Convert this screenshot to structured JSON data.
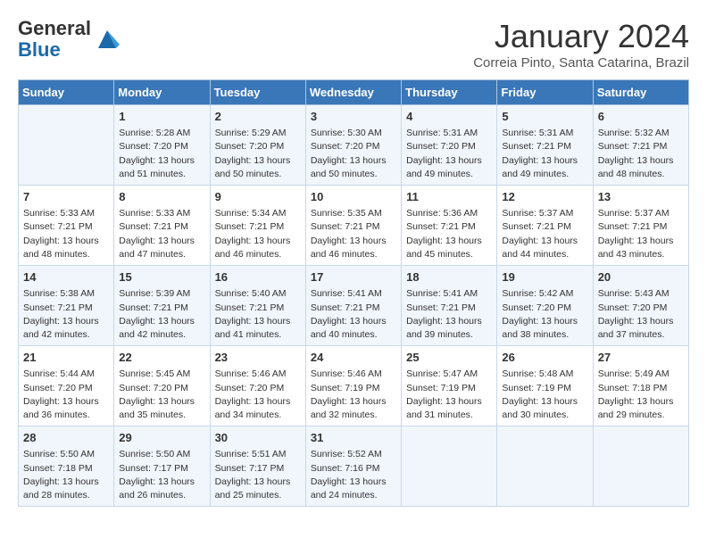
{
  "header": {
    "logo_line1": "General",
    "logo_line2": "Blue",
    "month_title": "January 2024",
    "location": "Correia Pinto, Santa Catarina, Brazil"
  },
  "calendar": {
    "days_of_week": [
      "Sunday",
      "Monday",
      "Tuesday",
      "Wednesday",
      "Thursday",
      "Friday",
      "Saturday"
    ],
    "weeks": [
      [
        {
          "day": "",
          "info": ""
        },
        {
          "day": "1",
          "info": "Sunrise: 5:28 AM\nSunset: 7:20 PM\nDaylight: 13 hours\nand 51 minutes."
        },
        {
          "day": "2",
          "info": "Sunrise: 5:29 AM\nSunset: 7:20 PM\nDaylight: 13 hours\nand 50 minutes."
        },
        {
          "day": "3",
          "info": "Sunrise: 5:30 AM\nSunset: 7:20 PM\nDaylight: 13 hours\nand 50 minutes."
        },
        {
          "day": "4",
          "info": "Sunrise: 5:31 AM\nSunset: 7:20 PM\nDaylight: 13 hours\nand 49 minutes."
        },
        {
          "day": "5",
          "info": "Sunrise: 5:31 AM\nSunset: 7:21 PM\nDaylight: 13 hours\nand 49 minutes."
        },
        {
          "day": "6",
          "info": "Sunrise: 5:32 AM\nSunset: 7:21 PM\nDaylight: 13 hours\nand 48 minutes."
        }
      ],
      [
        {
          "day": "7",
          "info": "Sunrise: 5:33 AM\nSunset: 7:21 PM\nDaylight: 13 hours\nand 48 minutes."
        },
        {
          "day": "8",
          "info": "Sunrise: 5:33 AM\nSunset: 7:21 PM\nDaylight: 13 hours\nand 47 minutes."
        },
        {
          "day": "9",
          "info": "Sunrise: 5:34 AM\nSunset: 7:21 PM\nDaylight: 13 hours\nand 46 minutes."
        },
        {
          "day": "10",
          "info": "Sunrise: 5:35 AM\nSunset: 7:21 PM\nDaylight: 13 hours\nand 46 minutes."
        },
        {
          "day": "11",
          "info": "Sunrise: 5:36 AM\nSunset: 7:21 PM\nDaylight: 13 hours\nand 45 minutes."
        },
        {
          "day": "12",
          "info": "Sunrise: 5:37 AM\nSunset: 7:21 PM\nDaylight: 13 hours\nand 44 minutes."
        },
        {
          "day": "13",
          "info": "Sunrise: 5:37 AM\nSunset: 7:21 PM\nDaylight: 13 hours\nand 43 minutes."
        }
      ],
      [
        {
          "day": "14",
          "info": "Sunrise: 5:38 AM\nSunset: 7:21 PM\nDaylight: 13 hours\nand 42 minutes."
        },
        {
          "day": "15",
          "info": "Sunrise: 5:39 AM\nSunset: 7:21 PM\nDaylight: 13 hours\nand 42 minutes."
        },
        {
          "day": "16",
          "info": "Sunrise: 5:40 AM\nSunset: 7:21 PM\nDaylight: 13 hours\nand 41 minutes."
        },
        {
          "day": "17",
          "info": "Sunrise: 5:41 AM\nSunset: 7:21 PM\nDaylight: 13 hours\nand 40 minutes."
        },
        {
          "day": "18",
          "info": "Sunrise: 5:41 AM\nSunset: 7:21 PM\nDaylight: 13 hours\nand 39 minutes."
        },
        {
          "day": "19",
          "info": "Sunrise: 5:42 AM\nSunset: 7:20 PM\nDaylight: 13 hours\nand 38 minutes."
        },
        {
          "day": "20",
          "info": "Sunrise: 5:43 AM\nSunset: 7:20 PM\nDaylight: 13 hours\nand 37 minutes."
        }
      ],
      [
        {
          "day": "21",
          "info": "Sunrise: 5:44 AM\nSunset: 7:20 PM\nDaylight: 13 hours\nand 36 minutes."
        },
        {
          "day": "22",
          "info": "Sunrise: 5:45 AM\nSunset: 7:20 PM\nDaylight: 13 hours\nand 35 minutes."
        },
        {
          "day": "23",
          "info": "Sunrise: 5:46 AM\nSunset: 7:20 PM\nDaylight: 13 hours\nand 34 minutes."
        },
        {
          "day": "24",
          "info": "Sunrise: 5:46 AM\nSunset: 7:19 PM\nDaylight: 13 hours\nand 32 minutes."
        },
        {
          "day": "25",
          "info": "Sunrise: 5:47 AM\nSunset: 7:19 PM\nDaylight: 13 hours\nand 31 minutes."
        },
        {
          "day": "26",
          "info": "Sunrise: 5:48 AM\nSunset: 7:19 PM\nDaylight: 13 hours\nand 30 minutes."
        },
        {
          "day": "27",
          "info": "Sunrise: 5:49 AM\nSunset: 7:18 PM\nDaylight: 13 hours\nand 29 minutes."
        }
      ],
      [
        {
          "day": "28",
          "info": "Sunrise: 5:50 AM\nSunset: 7:18 PM\nDaylight: 13 hours\nand 28 minutes."
        },
        {
          "day": "29",
          "info": "Sunrise: 5:50 AM\nSunset: 7:17 PM\nDaylight: 13 hours\nand 26 minutes."
        },
        {
          "day": "30",
          "info": "Sunrise: 5:51 AM\nSunset: 7:17 PM\nDaylight: 13 hours\nand 25 minutes."
        },
        {
          "day": "31",
          "info": "Sunrise: 5:52 AM\nSunset: 7:16 PM\nDaylight: 13 hours\nand 24 minutes."
        },
        {
          "day": "",
          "info": ""
        },
        {
          "day": "",
          "info": ""
        },
        {
          "day": "",
          "info": ""
        }
      ]
    ]
  }
}
